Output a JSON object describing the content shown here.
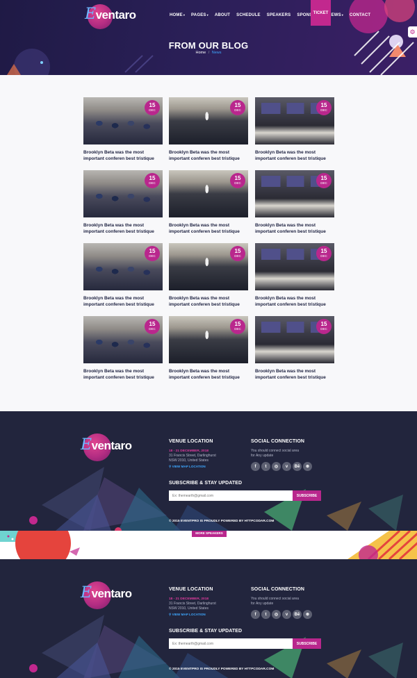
{
  "brand": {
    "logo_initial": "E",
    "logo_rest": "ventaro"
  },
  "nav": {
    "items": [
      {
        "label": "HOME",
        "caret": "▾"
      },
      {
        "label": "PAGES",
        "caret": "▾"
      },
      {
        "label": "ABOUT",
        "caret": ""
      },
      {
        "label": "SCHEDULE",
        "caret": ""
      },
      {
        "label": "SPEAKERS",
        "caret": ""
      },
      {
        "label": "SPONSORS",
        "caret": ""
      },
      {
        "label": "NEWS",
        "caret": "▾"
      },
      {
        "label": "CONTACT",
        "caret": ""
      }
    ],
    "ticket_label": "TICKET"
  },
  "hero": {
    "title": "FROM OUR BLOG",
    "breadcrumb": {
      "home": "Home",
      "separator": "/",
      "current": "News"
    }
  },
  "blog": {
    "posts": [
      {
        "day": "15",
        "month": "DEC",
        "title": "Brooklyn Beta was the most important conferen best tristique",
        "image": "audience"
      },
      {
        "day": "15",
        "month": "DEC",
        "title": "Brooklyn Beta was the most important conferen best tristique",
        "image": "speaker"
      },
      {
        "day": "15",
        "month": "DEC",
        "title": "Brooklyn Beta was the most important conferen best tristique",
        "image": "classroom"
      },
      {
        "day": "15",
        "month": "DEC",
        "title": "Brooklyn Beta was the most important conferen best tristique",
        "image": "audience"
      },
      {
        "day": "15",
        "month": "DEC",
        "title": "Brooklyn Beta was the most important conferen best tristique",
        "image": "speaker"
      },
      {
        "day": "15",
        "month": "DEC",
        "title": "Brooklyn Beta was the most important conferen best tristique",
        "image": "classroom"
      },
      {
        "day": "15",
        "month": "DEC",
        "title": "Brooklyn Beta was the most important conferen best tristique",
        "image": "audience"
      },
      {
        "day": "15",
        "month": "DEC",
        "title": "Brooklyn Beta was the most important conferen best tristique",
        "image": "speaker"
      },
      {
        "day": "15",
        "month": "DEC",
        "title": "Brooklyn Beta was the most important conferen best tristique",
        "image": "classroom"
      },
      {
        "day": "15",
        "month": "DEC",
        "title": "Brooklyn Beta was the most important conferen best tristique",
        "image": "audience"
      },
      {
        "day": "15",
        "month": "DEC",
        "title": "Brooklyn Beta was the most important conferen best tristique",
        "image": "speaker"
      },
      {
        "day": "15",
        "month": "DEC",
        "title": "Brooklyn Beta was the most important conferen best tristique",
        "image": "classroom"
      }
    ]
  },
  "footer": {
    "venue_title": "VENUE LOCATION",
    "venue_date": "18 - 21 DECEMBER, 2018",
    "address_line1": "31 Francis Street, Darlinghurst",
    "address_line2": "NSW 2010, United States",
    "map_link": "⚲ VIEW MAP LOCATION",
    "social_title": "SOCIAL CONNECTION",
    "social_line1": "You should connect social area",
    "social_line2": "for Any update",
    "socials": [
      {
        "glyph": "f",
        "icon": "facebook-icon"
      },
      {
        "glyph": "t",
        "icon": "twitter-icon"
      },
      {
        "glyph": "◎",
        "icon": "instagram-icon"
      },
      {
        "glyph": "v",
        "icon": "vimeo-icon"
      },
      {
        "glyph": "Bē",
        "icon": "behance-icon"
      },
      {
        "glyph": "⊛",
        "icon": "dribbble-icon"
      }
    ],
    "subscribe_title": "SUBSCRIBE & STAY UPDATED",
    "subscribe_placeholder": "Ex: themearth@gmail.com",
    "subscribe_button": "SUBSCRIBE",
    "copyright": "© 2015 EVENTPRO IS PROUDLY POWERED BY HTTPCODAR.COM"
  },
  "strip": {
    "more_speakers": "MORE SPEAKERS"
  },
  "colors": {
    "accent": "#b9278d",
    "dark": "#22253d",
    "link": "#3ea8ff",
    "hero": "#2a1f57"
  }
}
